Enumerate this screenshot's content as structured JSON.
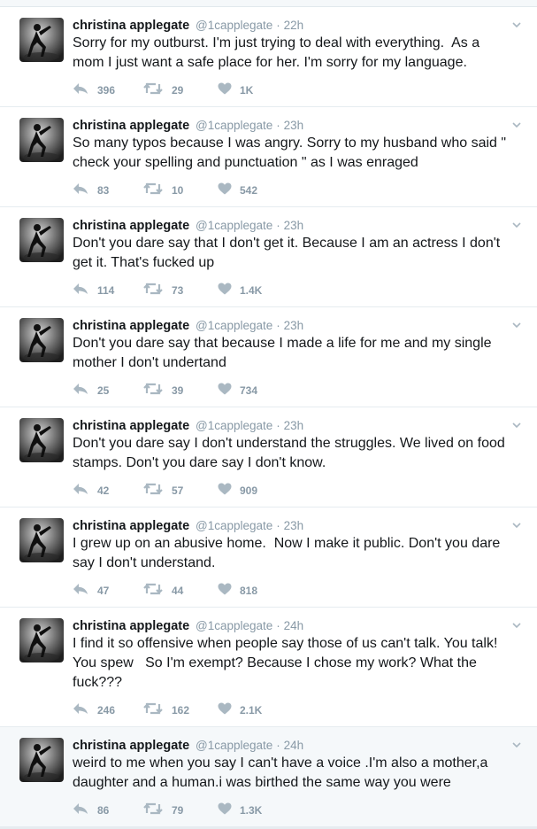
{
  "tweets": [
    {
      "name": "christina applegate",
      "handle": "@1capplegate",
      "separator": "·",
      "time": "22h",
      "text": "Sorry for my outburst. I'm just trying to deal with everything.  As a mom I just want a safe place for her. I'm sorry for my language.",
      "replies": "396",
      "retweets": "29",
      "likes": "1K"
    },
    {
      "name": "christina applegate",
      "handle": "@1capplegate",
      "separator": "·",
      "time": "23h",
      "text": "So many typos because I was angry. Sorry to my husband who said \" check your spelling and punctuation \" as I was enraged",
      "replies": "83",
      "retweets": "10",
      "likes": "542"
    },
    {
      "name": "christina applegate",
      "handle": "@1capplegate",
      "separator": "·",
      "time": "23h",
      "text": "Don't you dare say that I don't get it. Because I am an actress I don't get it. That's fucked up",
      "replies": "114",
      "retweets": "73",
      "likes": "1.4K"
    },
    {
      "name": "christina applegate",
      "handle": "@1capplegate",
      "separator": "·",
      "time": "23h",
      "text": "Don't you dare say that because I made a life for me and my single mother I don't undertand",
      "replies": "25",
      "retweets": "39",
      "likes": "734"
    },
    {
      "name": "christina applegate",
      "handle": "@1capplegate",
      "separator": "·",
      "time": "23h",
      "text": "Don't you dare say I don't understand the struggles. We lived on food stamps. Don't you dare say I don't know.",
      "replies": "42",
      "retweets": "57",
      "likes": "909"
    },
    {
      "name": "christina applegate",
      "handle": "@1capplegate",
      "separator": "·",
      "time": "23h",
      "text": "I grew up on an abusive home.  Now I make it public. Don't you dare say I don't understand.",
      "replies": "47",
      "retweets": "44",
      "likes": "818"
    },
    {
      "name": "christina applegate",
      "handle": "@1capplegate",
      "separator": "·",
      "time": "24h",
      "text": "I find it so offensive when people say those of us can't talk. You talk! You spew   So I'm exempt? Because I chose my work? What the fuck???",
      "replies": "246",
      "retweets": "162",
      "likes": "2.1K"
    },
    {
      "name": "christina applegate",
      "handle": "@1capplegate",
      "separator": "·",
      "time": "24h",
      "text": "weird to me when you say I can't have a voice .I'm also a mother,a daughter and a human.i was birthed the same way you were",
      "replies": "86",
      "retweets": "79",
      "likes": "1.3K"
    }
  ],
  "icons": {
    "reply": "reply-icon",
    "retweet": "retweet-icon",
    "like": "heart-icon",
    "menu": "chevron-down-icon"
  },
  "colors": {
    "text": "#14171a",
    "muted": "#8899a6",
    "divider": "#e6ecf0",
    "hover_background": "#f5f8fa"
  }
}
